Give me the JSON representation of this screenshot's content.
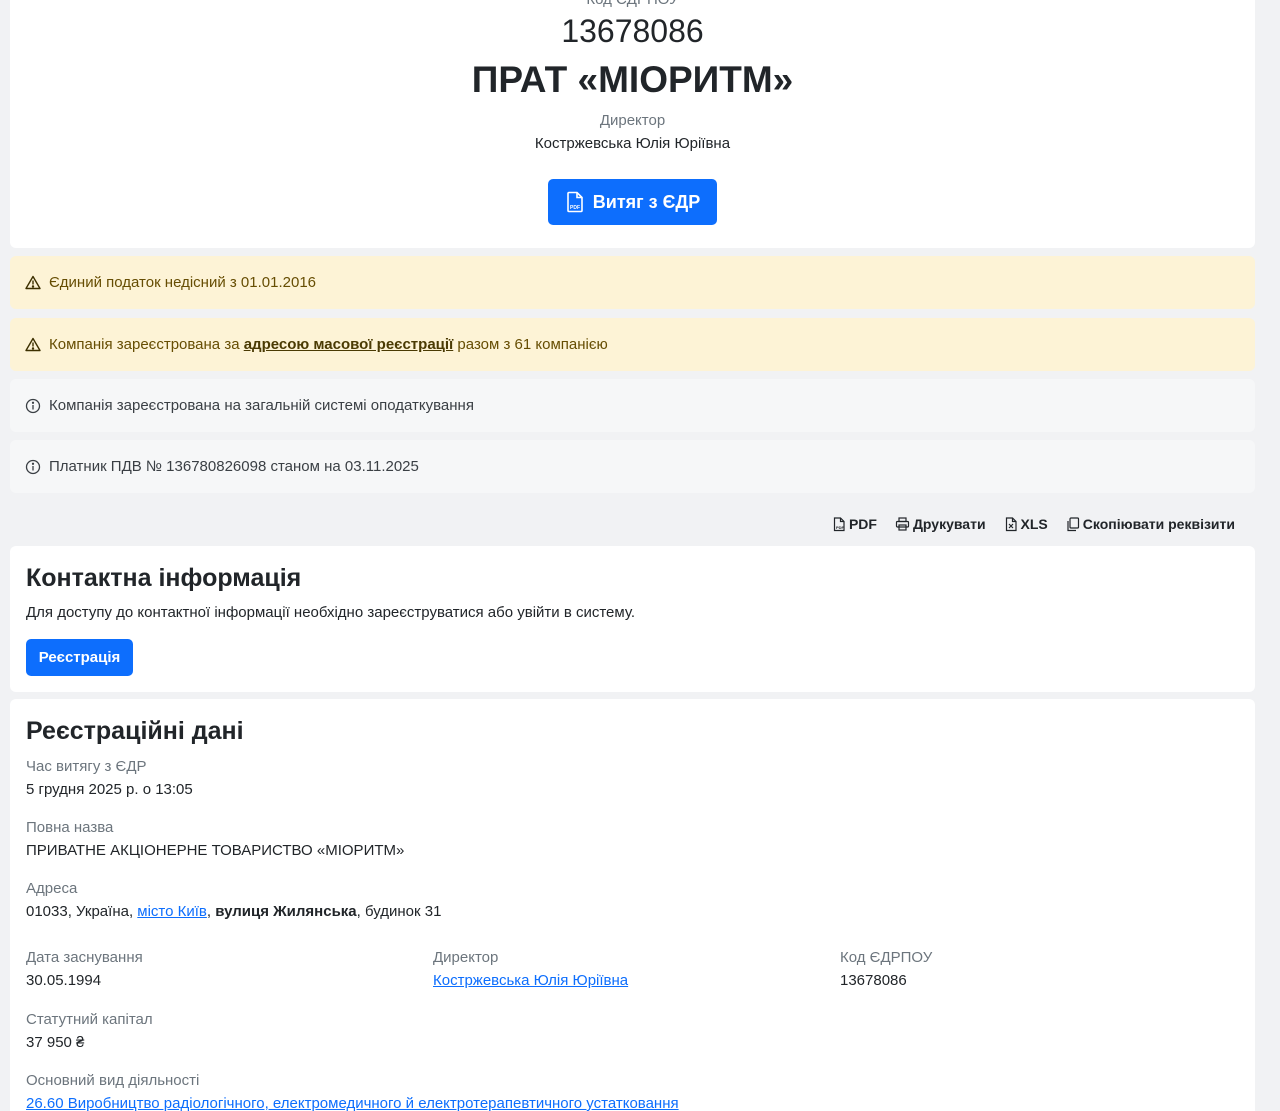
{
  "header": {
    "code_label": "Код ЄДРПОУ",
    "code_value": "13678086",
    "company_name": "ПРАТ «МІОРИТМ»",
    "director_label": "Директор",
    "director_name": "Костржевська Юлія Юріївна",
    "extract_button": "Витяг з ЄДР"
  },
  "alerts": {
    "single_tax": "Єдиний податок недісний з 01.01.2016",
    "mass_reg_prefix": "Компанія зареєстрована за ",
    "mass_reg_link": "адресою масової реєстрації",
    "mass_reg_suffix": " разом з 61 компанією",
    "tax_system": "Компанія зареєстрована на загальній системі оподаткування",
    "vat": "Платник ПДВ № 136780826098 станом на 03.11.2025"
  },
  "toolbar": {
    "pdf": "PDF",
    "print": "Друкувати",
    "xls": "XLS",
    "copy": "Скопіювати реквізити"
  },
  "contact": {
    "title": "Контактна інформація",
    "text": "Для доступу до контактної інформації необхідно зареєструватися або увійти в систему.",
    "register_button": "Реєстрація"
  },
  "registration": {
    "title": "Реєстраційні дані",
    "extract_time_label": "Час витягу з ЄДР",
    "extract_time_value": "5 грудня 2025 р. о 13:05",
    "full_name_label": "Повна назва",
    "full_name_value": "ПРИВАТНЕ АКЦІОНЕРНЕ ТОВАРИСТВО «МІОРИТМ»",
    "address_label": "Адреса",
    "address_prefix": "01033, Україна, ",
    "address_city": "місто Київ",
    "address_sep": ", ",
    "address_street": "вулиця Жилянська",
    "address_suffix": ", будинок 31",
    "founded_label": "Дата заснування",
    "founded_value": "30.05.1994",
    "director_label": "Директор",
    "director_value": "Костржевська Юлія Юріївна",
    "code_label": "Код ЄДРПОУ",
    "code_value": "13678086",
    "capital_label": "Статутний капітал",
    "capital_value": "37 950 ₴",
    "activity_label": "Основний вид діяльності",
    "activity_value": "26.60 Виробництво радіологічного, електромедичного й електротерапевтичного устатковання"
  },
  "colors": {
    "primary": "#0d6efd",
    "warning_bg": "#fdf3d6",
    "warning_text": "#664d03",
    "info_bg": "#f6f7f8",
    "page_bg": "#f1f2f4"
  }
}
